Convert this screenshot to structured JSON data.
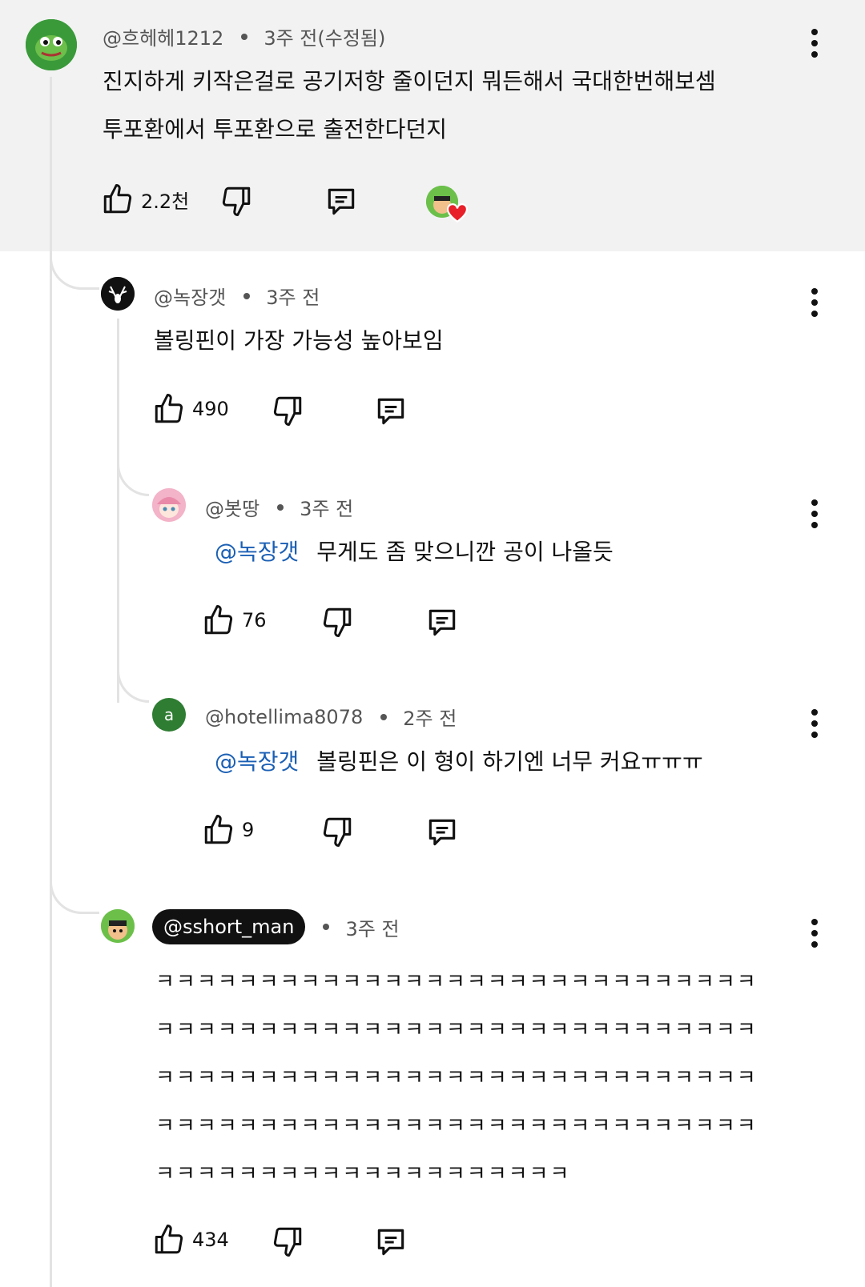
{
  "comments": [
    {
      "handle": "@흐헤헤1212",
      "time": "3주 전(수정됨)",
      "text_lines": [
        "진지하게 키작은걸로 공기저항 줄이던지 뭐든해서 국대한번해보셈",
        "투포환에서 투포환으로 출전한다던지"
      ],
      "likes": "2.2천",
      "avatar_icon": "frog-avatar-icon"
    },
    {
      "handle": "@녹장갯",
      "time": "3주 전",
      "text": "볼링핀이 가장 가능성 높아보임",
      "likes": "490",
      "avatar_icon": "deer-avatar-icon"
    },
    {
      "handle": "@봇땅",
      "time": "3주 전",
      "mention": "@녹장갯",
      "text": "무게도 좀 맞으니깐 공이 나올듯",
      "likes": "76",
      "avatar_icon": "pink-hair-avatar-icon"
    },
    {
      "handle": "@hotellima8078",
      "time": "2주 전",
      "avatar_letter": "a",
      "mention": "@녹장갯",
      "text": "볼링핀은 이 형이 하기엔 너무 커요ㅠㅠㅠ",
      "likes": "9"
    },
    {
      "handle": "@sshort_man",
      "time": "3주 전",
      "text_lines": [
        "ㅋㅋㅋㅋㅋㅋㅋㅋㅋㅋㅋㅋㅋㅋㅋㅋㅋㅋㅋㅋㅋㅋㅋㅋㅋㅋㅋㅋㅋ",
        "ㅋㅋㅋㅋㅋㅋㅋㅋㅋㅋㅋㅋㅋㅋㅋㅋㅋㅋㅋㅋㅋㅋㅋㅋㅋㅋㅋㅋㅋ",
        "ㅋㅋㅋㅋㅋㅋㅋㅋㅋㅋㅋㅋㅋㅋㅋㅋㅋㅋㅋㅋㅋㅋㅋㅋㅋㅋㅋㅋㅋ",
        "ㅋㅋㅋㅋㅋㅋㅋㅋㅋㅋㅋㅋㅋㅋㅋㅋㅋㅋㅋㅋㅋㅋㅋㅋㅋㅋㅋㅋㅋ",
        "ㅋㅋㅋㅋㅋㅋㅋㅋㅋㅋㅋㅋㅋㅋㅋㅋㅋㅋㅋㅋ"
      ],
      "likes": "434",
      "avatar_icon": "cartoon-avatar-icon"
    }
  ],
  "creator_heart": {
    "badge_icon": "heart-icon",
    "color": "#e8202a"
  },
  "colors": {
    "highlight_bg": "#f2f2f2",
    "mention": "#1a5fb4",
    "thread_line": "#e3e3e3",
    "letter_avatar": "#2e7d32"
  }
}
